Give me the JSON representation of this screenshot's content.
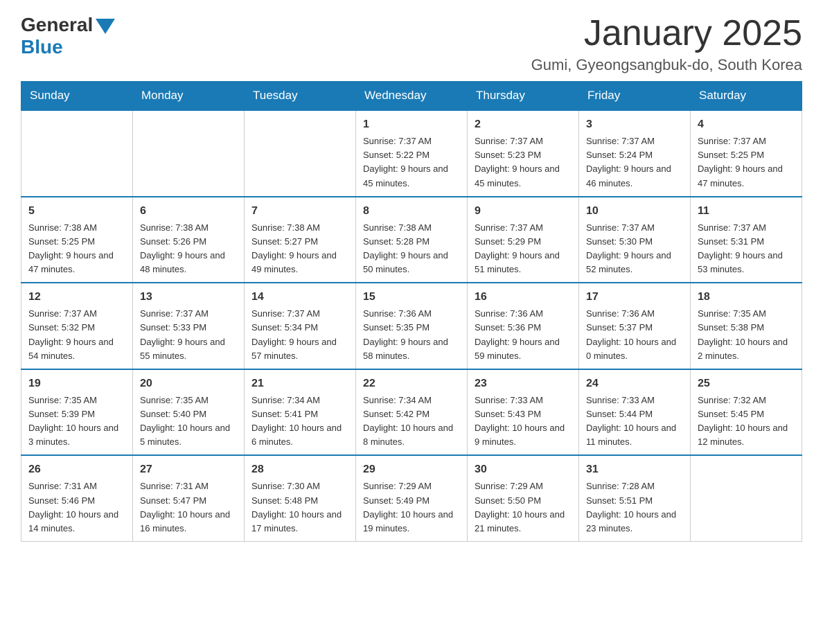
{
  "header": {
    "logo_general": "General",
    "logo_blue": "Blue",
    "month_title": "January 2025",
    "location": "Gumi, Gyeongsangbuk-do, South Korea"
  },
  "days_of_week": [
    "Sunday",
    "Monday",
    "Tuesday",
    "Wednesday",
    "Thursday",
    "Friday",
    "Saturday"
  ],
  "weeks": [
    [
      {
        "day": "",
        "info": ""
      },
      {
        "day": "",
        "info": ""
      },
      {
        "day": "",
        "info": ""
      },
      {
        "day": "1",
        "info": "Sunrise: 7:37 AM\nSunset: 5:22 PM\nDaylight: 9 hours and 45 minutes."
      },
      {
        "day": "2",
        "info": "Sunrise: 7:37 AM\nSunset: 5:23 PM\nDaylight: 9 hours and 45 minutes."
      },
      {
        "day": "3",
        "info": "Sunrise: 7:37 AM\nSunset: 5:24 PM\nDaylight: 9 hours and 46 minutes."
      },
      {
        "day": "4",
        "info": "Sunrise: 7:37 AM\nSunset: 5:25 PM\nDaylight: 9 hours and 47 minutes."
      }
    ],
    [
      {
        "day": "5",
        "info": "Sunrise: 7:38 AM\nSunset: 5:25 PM\nDaylight: 9 hours and 47 minutes."
      },
      {
        "day": "6",
        "info": "Sunrise: 7:38 AM\nSunset: 5:26 PM\nDaylight: 9 hours and 48 minutes."
      },
      {
        "day": "7",
        "info": "Sunrise: 7:38 AM\nSunset: 5:27 PM\nDaylight: 9 hours and 49 minutes."
      },
      {
        "day": "8",
        "info": "Sunrise: 7:38 AM\nSunset: 5:28 PM\nDaylight: 9 hours and 50 minutes."
      },
      {
        "day": "9",
        "info": "Sunrise: 7:37 AM\nSunset: 5:29 PM\nDaylight: 9 hours and 51 minutes."
      },
      {
        "day": "10",
        "info": "Sunrise: 7:37 AM\nSunset: 5:30 PM\nDaylight: 9 hours and 52 minutes."
      },
      {
        "day": "11",
        "info": "Sunrise: 7:37 AM\nSunset: 5:31 PM\nDaylight: 9 hours and 53 minutes."
      }
    ],
    [
      {
        "day": "12",
        "info": "Sunrise: 7:37 AM\nSunset: 5:32 PM\nDaylight: 9 hours and 54 minutes."
      },
      {
        "day": "13",
        "info": "Sunrise: 7:37 AM\nSunset: 5:33 PM\nDaylight: 9 hours and 55 minutes."
      },
      {
        "day": "14",
        "info": "Sunrise: 7:37 AM\nSunset: 5:34 PM\nDaylight: 9 hours and 57 minutes."
      },
      {
        "day": "15",
        "info": "Sunrise: 7:36 AM\nSunset: 5:35 PM\nDaylight: 9 hours and 58 minutes."
      },
      {
        "day": "16",
        "info": "Sunrise: 7:36 AM\nSunset: 5:36 PM\nDaylight: 9 hours and 59 minutes."
      },
      {
        "day": "17",
        "info": "Sunrise: 7:36 AM\nSunset: 5:37 PM\nDaylight: 10 hours and 0 minutes."
      },
      {
        "day": "18",
        "info": "Sunrise: 7:35 AM\nSunset: 5:38 PM\nDaylight: 10 hours and 2 minutes."
      }
    ],
    [
      {
        "day": "19",
        "info": "Sunrise: 7:35 AM\nSunset: 5:39 PM\nDaylight: 10 hours and 3 minutes."
      },
      {
        "day": "20",
        "info": "Sunrise: 7:35 AM\nSunset: 5:40 PM\nDaylight: 10 hours and 5 minutes."
      },
      {
        "day": "21",
        "info": "Sunrise: 7:34 AM\nSunset: 5:41 PM\nDaylight: 10 hours and 6 minutes."
      },
      {
        "day": "22",
        "info": "Sunrise: 7:34 AM\nSunset: 5:42 PM\nDaylight: 10 hours and 8 minutes."
      },
      {
        "day": "23",
        "info": "Sunrise: 7:33 AM\nSunset: 5:43 PM\nDaylight: 10 hours and 9 minutes."
      },
      {
        "day": "24",
        "info": "Sunrise: 7:33 AM\nSunset: 5:44 PM\nDaylight: 10 hours and 11 minutes."
      },
      {
        "day": "25",
        "info": "Sunrise: 7:32 AM\nSunset: 5:45 PM\nDaylight: 10 hours and 12 minutes."
      }
    ],
    [
      {
        "day": "26",
        "info": "Sunrise: 7:31 AM\nSunset: 5:46 PM\nDaylight: 10 hours and 14 minutes."
      },
      {
        "day": "27",
        "info": "Sunrise: 7:31 AM\nSunset: 5:47 PM\nDaylight: 10 hours and 16 minutes."
      },
      {
        "day": "28",
        "info": "Sunrise: 7:30 AM\nSunset: 5:48 PM\nDaylight: 10 hours and 17 minutes."
      },
      {
        "day": "29",
        "info": "Sunrise: 7:29 AM\nSunset: 5:49 PM\nDaylight: 10 hours and 19 minutes."
      },
      {
        "day": "30",
        "info": "Sunrise: 7:29 AM\nSunset: 5:50 PM\nDaylight: 10 hours and 21 minutes."
      },
      {
        "day": "31",
        "info": "Sunrise: 7:28 AM\nSunset: 5:51 PM\nDaylight: 10 hours and 23 minutes."
      },
      {
        "day": "",
        "info": ""
      }
    ]
  ]
}
